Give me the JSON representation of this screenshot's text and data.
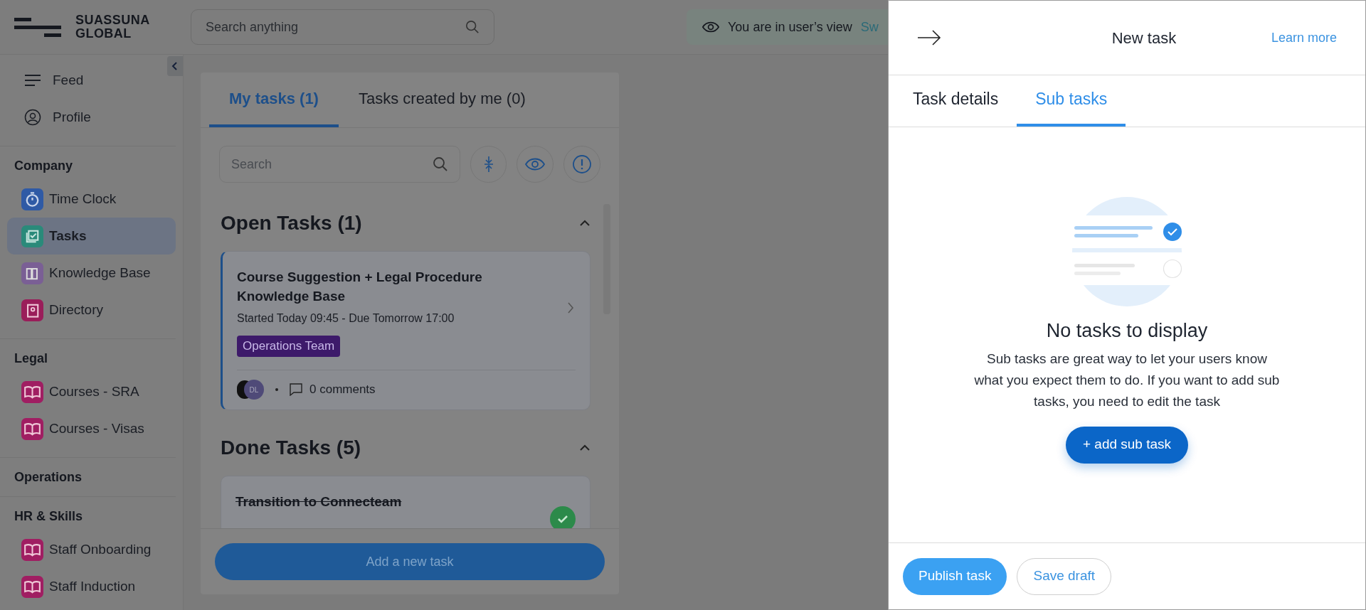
{
  "header": {
    "logo_lines": [
      "SUASSUNA",
      "GLOBAL"
    ],
    "search": {
      "placeholder": "Search anything"
    },
    "view_notice": "You are in user’s view",
    "view_link": "Sw"
  },
  "sidebar": {
    "top_items": [
      {
        "label": "Feed",
        "kind": "menu"
      },
      {
        "label": "Profile",
        "kind": "person"
      }
    ],
    "sections": [
      {
        "title": "Company",
        "items": [
          {
            "label": "Time Clock",
            "kind": "clock",
            "color": "#2f5aa5",
            "selected": false
          },
          {
            "label": "Tasks",
            "kind": "tasks",
            "color": "#2a8a7a",
            "selected": true
          },
          {
            "label": "Knowledge Base",
            "kind": "library",
            "color": "#7a5f95",
            "selected": false
          },
          {
            "label": "Directory",
            "kind": "directory",
            "color": "#9a1e5a",
            "selected": false
          }
        ]
      },
      {
        "title": "Legal",
        "items": [
          {
            "label": "Courses - SRA",
            "kind": "book",
            "color": "#a01e62",
            "selected": false
          },
          {
            "label": "Courses - Visas",
            "kind": "book",
            "color": "#a01e62",
            "selected": false
          }
        ]
      },
      {
        "title": "Operations"
      },
      {
        "title": "HR & Skills",
        "items": [
          {
            "label": "Staff Onboarding",
            "kind": "book",
            "color": "#a01e62",
            "selected": false
          },
          {
            "label": "Staff Induction",
            "kind": "book",
            "color": "#a01e62",
            "selected": false
          }
        ]
      }
    ]
  },
  "tasks_panel": {
    "tabs": [
      {
        "label": "My tasks (1)",
        "selected": true
      },
      {
        "label": "Tasks created by me (0)",
        "selected": false
      }
    ],
    "search": {
      "placeholder": "Search"
    },
    "groups": [
      {
        "title": "Open Tasks (1)",
        "expanded": true,
        "tasks": [
          {
            "title": "Course Suggestion + Legal Procedure Knowledge Base",
            "schedule": "Started Today 09:45 - Due Tomorrow 17:00",
            "tag": "Operations Team",
            "avatar": "DL",
            "comments": "0 comments",
            "done": false
          }
        ]
      },
      {
        "title": "Done Tasks (5)",
        "expanded": true,
        "tasks": [
          {
            "title": "Transition to Connecteam",
            "done": true
          }
        ]
      }
    ],
    "add_button": "Add a new task"
  },
  "drawer": {
    "title": "New task",
    "learn_more": "Learn more",
    "tabs": [
      {
        "label": "Task details",
        "selected": false
      },
      {
        "label": "Sub tasks",
        "selected": true
      }
    ],
    "empty": {
      "heading": "No tasks to display",
      "text": "Sub tasks are great way to let your users know what you expect them to do. If you want to add sub tasks, you need to edit the task",
      "button": "+ add sub task"
    },
    "footer": {
      "primary": "Publish task",
      "secondary": "Save draft"
    }
  }
}
